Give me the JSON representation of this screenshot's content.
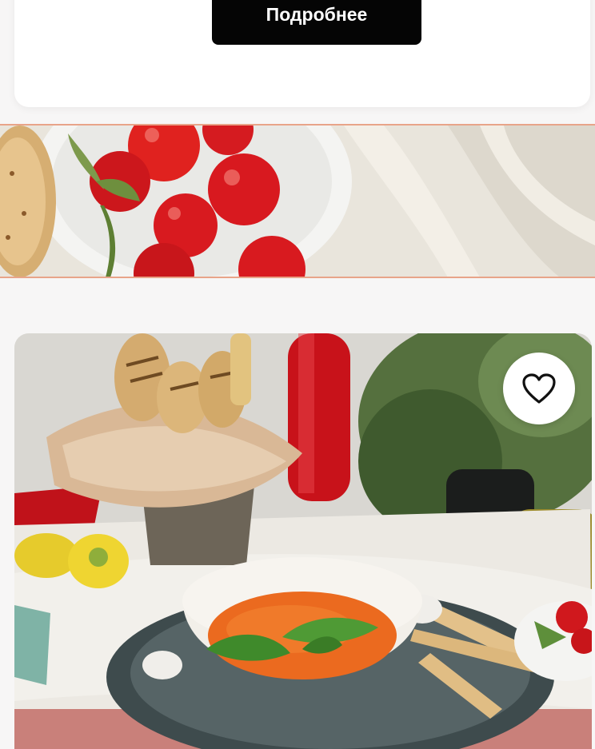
{
  "promo_card": {
    "more_button_label": "Подробнее"
  },
  "banner": {
    "image": "tomatoes-bowl-with-bread-on-linen"
  },
  "dish_card": {
    "image": "tomato-soup-with-basil-and-breadsticks",
    "favorite_icon": "heart-outline-icon"
  },
  "colors": {
    "button_bg": "#050505",
    "banner_border": "#e8a489",
    "page_bg": "#f7f6f6"
  }
}
